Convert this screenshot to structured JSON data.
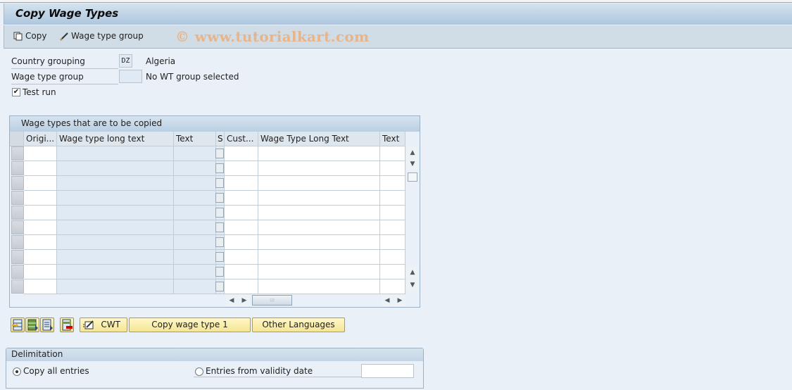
{
  "title": "Copy Wage Types",
  "toolbar": {
    "copy_label": "Copy",
    "wage_type_group_label": "Wage type group",
    "watermark": "© www.tutorialkart.com"
  },
  "form": {
    "country_grouping_label": "Country grouping",
    "country_grouping_value": "DZ",
    "country_grouping_text": "Algeria",
    "wage_type_group_label": "Wage type group",
    "wage_type_group_value": "",
    "wage_type_group_text": "No WT group selected",
    "test_run_label": "Test run",
    "test_run_checked": true
  },
  "table": {
    "title": "Wage types that are to be copied",
    "columns": [
      "Origi...",
      "Wage type long text",
      "Text",
      "S",
      "Cust...",
      "Wage Type Long Text",
      "Text"
    ],
    "row_count": 10,
    "rows": []
  },
  "actions": {
    "icon_buttons": [
      "insert-row-icon",
      "select-all-icon",
      "deselect-all-icon",
      "delete-row-icon"
    ],
    "cwt_label": "CWT",
    "copy_wage_type_label": "Copy wage type 1",
    "other_languages_label": "Other Languages"
  },
  "delimitation": {
    "title": "Delimitation",
    "copy_all_label": "Copy all entries",
    "copy_all_selected": true,
    "from_date_label": "Entries from validity date",
    "from_date_selected": false,
    "date_value": ""
  }
}
